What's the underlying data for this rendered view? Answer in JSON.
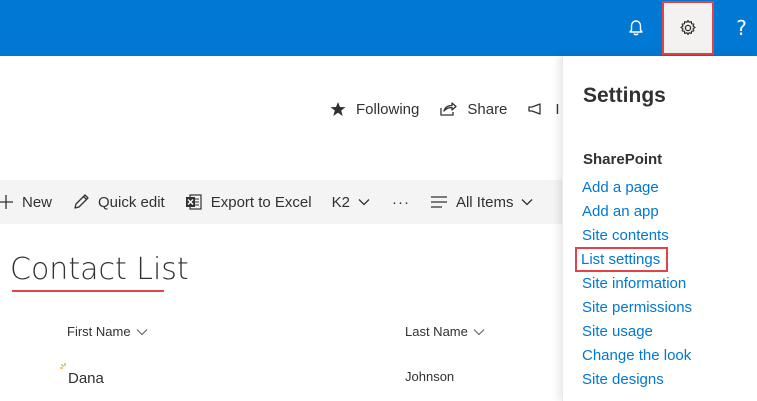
{
  "suite_bar": {
    "help_label": "?"
  },
  "site_actions": {
    "following": "Following",
    "share": "Share",
    "third_partial": "I"
  },
  "command_bar": {
    "new": "New",
    "quick_edit": "Quick edit",
    "export": "Export to Excel",
    "k2": "K2",
    "more": "···",
    "view": "All Items"
  },
  "list": {
    "title": "Contact List",
    "columns": [
      "First Name",
      "Last Name"
    ],
    "rows": [
      {
        "first_name": "Dana",
        "last_name": "Johnson"
      }
    ]
  },
  "settings_panel": {
    "title": "Settings",
    "section": "SharePoint",
    "links": [
      "Add a page",
      "Add an app",
      "Site contents",
      "List settings",
      "Site information",
      "Site permissions",
      "Site usage",
      "Change the look",
      "Site designs"
    ]
  },
  "colors": {
    "suite_bar": "#0078d4",
    "link": "#0078d4",
    "highlight": "#e2434b"
  }
}
